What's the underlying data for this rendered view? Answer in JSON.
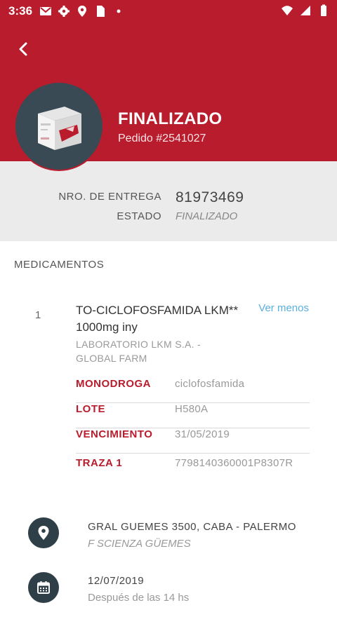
{
  "status_bar": {
    "time": "3:36"
  },
  "header": {
    "status": "FINALIZADO",
    "order_number": "Pedido #2541027",
    "accent_color": "#b91c2c"
  },
  "summary": {
    "delivery_label": "NRO. DE ENTREGA",
    "delivery_value": "81973469",
    "state_label": "ESTADO",
    "state_value": "FINALIZADO"
  },
  "medications": {
    "section_title": "MEDICAMENTOS",
    "items": [
      {
        "index": "1",
        "name": "TO-CICLOFOSFAMIDA LKM** 1000mg iny",
        "laboratory": "LABORATORIO  LKM S.A. - GLOBAL FARM",
        "toggle_label": "Ver menos",
        "details": [
          {
            "key": "MONODROGA",
            "value": "ciclofosfamida"
          },
          {
            "key": "LOTE",
            "value": "H580A"
          },
          {
            "key": "VENCIMIENTO",
            "value": "31/05/2019"
          },
          {
            "key": "TRAZA 1",
            "value": "7798140360001P8307R"
          }
        ]
      }
    ]
  },
  "delivery": {
    "address": "GRAL GUEMES 3500, CABA - PALERMO",
    "branch": "F SCIENZA GÜEMES",
    "date": "12/07/2019",
    "time_note": "Después de las 14 hs"
  },
  "icons": {
    "back": "arrow-left-icon",
    "location": "location-pin-icon",
    "calendar": "calendar-icon"
  }
}
